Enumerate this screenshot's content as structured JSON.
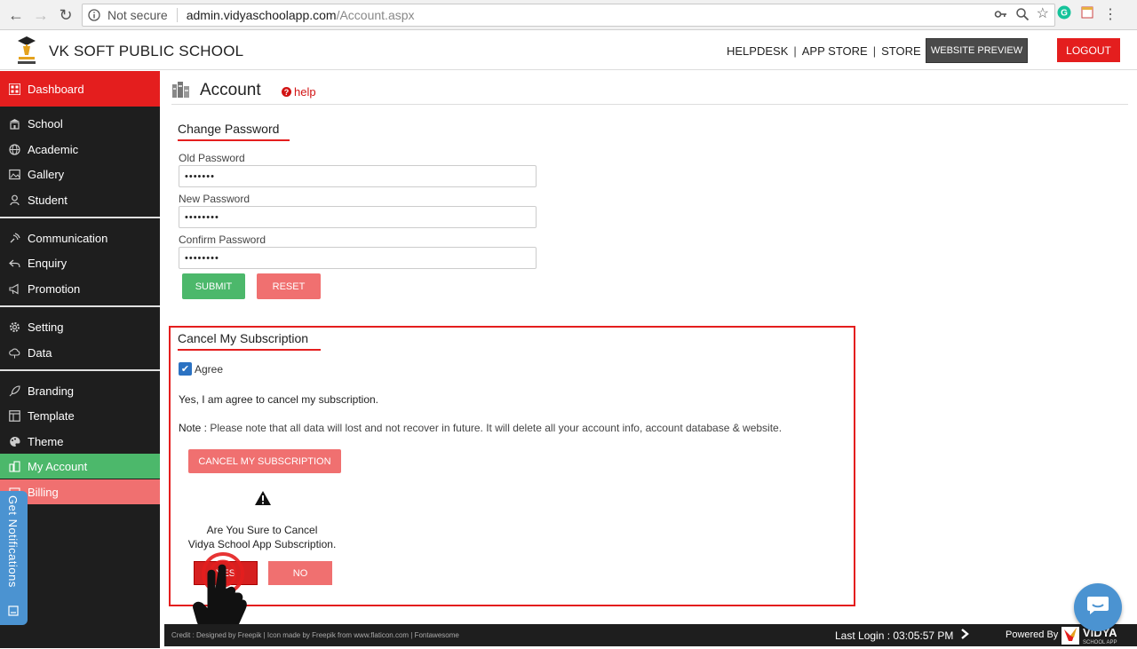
{
  "browser": {
    "not_secure": "Not secure",
    "url_host": "admin.vidyaschoolapp.com",
    "url_path": "/Account.aspx"
  },
  "header": {
    "school_name": "VK SOFT PUBLIC SCHOOL",
    "links": [
      "HELPDESK",
      "APP STORE",
      "STORE"
    ],
    "preview_label": "WEBSITE PREVIEW",
    "logout_label": "LOGOUT"
  },
  "sidebar": {
    "dashboard": "Dashboard",
    "items": [
      {
        "label": "School",
        "icon": "school-icon"
      },
      {
        "label": "Academic",
        "icon": "globe-icon"
      },
      {
        "label": "Gallery",
        "icon": "image-icon"
      },
      {
        "label": "Student",
        "icon": "student-icon"
      },
      {
        "label": "Communication",
        "icon": "satellite-icon"
      },
      {
        "label": "Enquiry",
        "icon": "reply-icon"
      },
      {
        "label": "Promotion",
        "icon": "megaphone-icon"
      },
      {
        "label": "Setting",
        "icon": "gear-icon"
      },
      {
        "label": "Data",
        "icon": "cloud-icon"
      },
      {
        "label": "Branding",
        "icon": "rocket-icon"
      },
      {
        "label": "Template",
        "icon": "template-icon"
      },
      {
        "label": "Theme",
        "icon": "palette-icon"
      },
      {
        "label": "My Account",
        "icon": "account-icon"
      },
      {
        "label": "Billing",
        "icon": "billing-icon"
      }
    ],
    "notifications_tab": "Get Notifications"
  },
  "page": {
    "title": "Account",
    "help": "help"
  },
  "change_password": {
    "title": "Change Password",
    "old_label": "Old Password",
    "old_value": "•••••••",
    "new_label": "New Password",
    "new_value": "••••••••",
    "confirm_label": "Confirm Password",
    "confirm_value": "••••••••",
    "submit": "SUBMIT",
    "reset": "RESET"
  },
  "cancel": {
    "title": "Cancel My Subscription",
    "agree": "Agree",
    "statement": "Yes, I am agree to cancel my subscription.",
    "note_label": "Note :",
    "note_text": "Please note that all data will lost and not recover in future. It will delete all your account info, account database & website.",
    "button": "CANCEL MY SUBSCRIPTION",
    "confirm_line1": "Are You Sure to Cancel",
    "confirm_line2": "Vidya School App Subscription.",
    "yes": "YES",
    "no": "NO"
  },
  "footer": {
    "credit": "Credit : Designed by Freepik | Icon made by Freepik from www.flaticon.com | Fontawesome",
    "last_login": "Last Login : 03:05:57 PM",
    "powered": "Powered By"
  },
  "colors": {
    "red": "#e41e1e",
    "green": "#4cb86b",
    "pink": "#f07070",
    "blue": "#4b93d1",
    "dark": "#1e1e1e"
  }
}
